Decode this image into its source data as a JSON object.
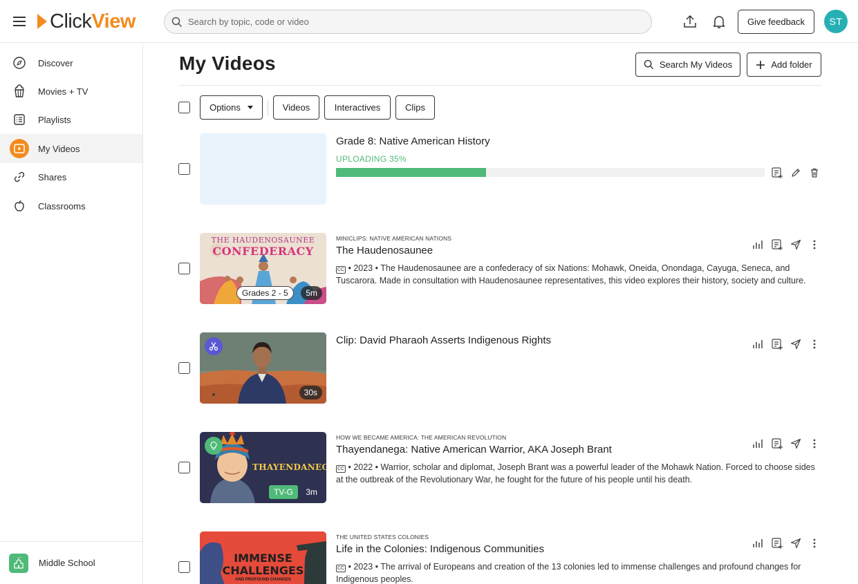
{
  "brand": {
    "logo_first": "Click",
    "logo_second": "View",
    "accent": "#f28c1e"
  },
  "search": {
    "placeholder": "Search by topic, code or video"
  },
  "header": {
    "feedback_label": "Give feedback",
    "avatar_initials": "ST",
    "avatar_color": "#27b0b4"
  },
  "sidebar": {
    "items": [
      {
        "label": "Discover",
        "icon": "compass-icon"
      },
      {
        "label": "Movies + TV",
        "icon": "popcorn-icon"
      },
      {
        "label": "Playlists",
        "icon": "list-icon"
      },
      {
        "label": "My Videos",
        "icon": "video-play-icon",
        "active": true
      },
      {
        "label": "Shares",
        "icon": "link-icon"
      },
      {
        "label": "Classrooms",
        "icon": "apple-icon"
      }
    ],
    "footer": {
      "label": "Middle School",
      "icon": "school-icon"
    }
  },
  "main": {
    "title": "My Videos",
    "search_my_videos_label": "Search My Videos",
    "add_folder_label": "Add folder",
    "filters": {
      "options_label": "Options",
      "videos_label": "Videos",
      "interactives_label": "Interactives",
      "clips_label": "Clips"
    },
    "upload": {
      "title": "Grade 8: Native American History",
      "status": "UPLOADING 35%",
      "progress": 0.35
    },
    "videos": [
      {
        "series": "MINICLIPS: NATIVE AMERICAN NATIONS",
        "title": "The Haudenosaunee",
        "cc": "CC",
        "year": "2023",
        "description": "The Haudenosaunee are a confederacy of six Nations: Mohawk, Oneida, Onondaga, Cayuga, Seneca, and Tuscarora. Made in consultation with Haudenosaunee representatives, this video explores their history, society and culture.",
        "thumb_text_line1": "THE HAUDENOSAUNEE",
        "thumb_text_line2": "CONFEDERACY",
        "grades": "Grades 2 - 5",
        "duration": "5m"
      },
      {
        "series": "",
        "title": "Clip: David Pharaoh Asserts Indigenous Rights",
        "duration": "30s"
      },
      {
        "series": "HOW WE BECAME AMERICA: THE AMERICAN REVOLUTION",
        "title": "Thayendanega: Native American Warrior, AKA Joseph Brant",
        "cc": "CC",
        "year": "2022",
        "description": "Warrior, scholar and diplomat, Joseph Brant was a powerful leader of the Mohawk Nation. Forced to choose sides at the outbreak of the Revolutionary War, he fought for the future of his people until his death.",
        "thumb_text": "THAYENDANEGA",
        "rating": "TV-G",
        "duration": "3m"
      },
      {
        "series": "THE UNITED STATES COLONIES",
        "title": "Life in the Colonies: Indigenous Communities",
        "cc": "CC",
        "year": "2023",
        "description": "The arrival of Europeans and creation of the 13 colonies led to immense challenges and profound changes for Indigenous peoples.",
        "thumb_text_line1": "IMMENSE",
        "thumb_text_line2": "CHALLENGES",
        "thumb_text_line3": "AND PROFOUND CHANGES"
      }
    ],
    "separator": "•"
  }
}
